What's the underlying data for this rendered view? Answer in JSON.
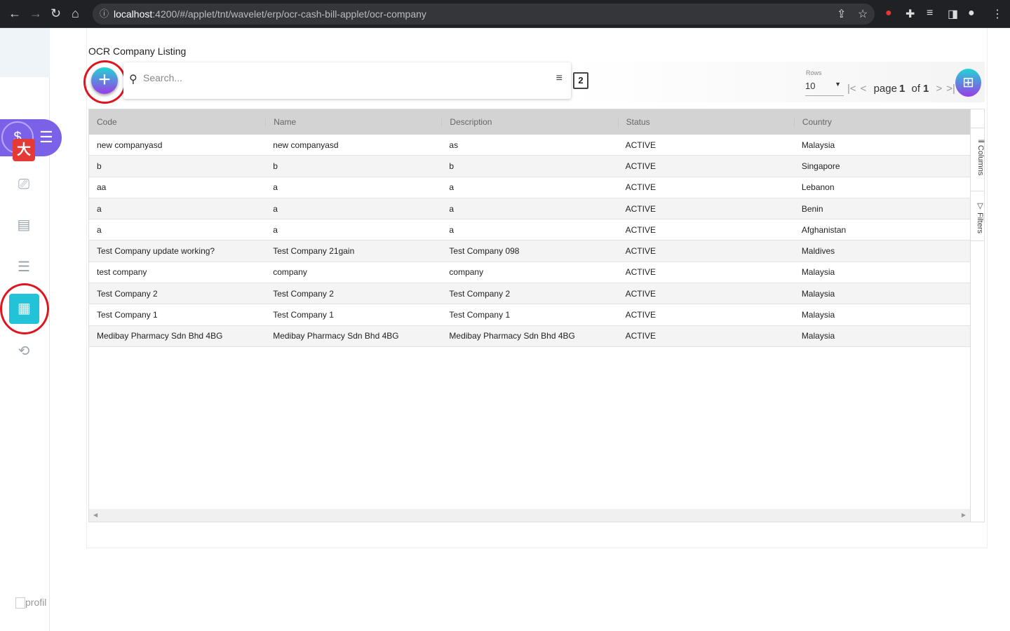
{
  "browser": {
    "url_host": "localhost",
    "url_path": ":4200/#/applet/tnt/wavelet/erp/ocr-cash-bill-applet/ocr-company"
  },
  "sidebar": {
    "profile_label": "profil"
  },
  "page": {
    "title": "OCR Company Listing",
    "search_placeholder": "Search...",
    "copy_badge": "2"
  },
  "pagination": {
    "rows_label": "Rows",
    "rows_value": "10",
    "page_word": "page",
    "current_page": "1",
    "of_word": "of",
    "total_pages": "1"
  },
  "side_tabs": {
    "columns": "Columns",
    "filters": "Filters"
  },
  "table": {
    "headers": [
      "Code",
      "Name",
      "Description",
      "Status",
      "Country"
    ],
    "rows": [
      [
        "new companyasd",
        "new companyasd",
        "as",
        "ACTIVE",
        "Malaysia"
      ],
      [
        "b",
        "b",
        "b",
        "ACTIVE",
        "Singapore"
      ],
      [
        "aa",
        "a",
        "a",
        "ACTIVE",
        "Lebanon"
      ],
      [
        "a",
        "a",
        "a",
        "ACTIVE",
        "Benin"
      ],
      [
        "a",
        "a",
        "a",
        "ACTIVE",
        "Afghanistan"
      ],
      [
        "Test Company update working?",
        "Test Company 21gain",
        "Test Company 098",
        "ACTIVE",
        "Maldives"
      ],
      [
        "test company",
        "company",
        "company",
        "ACTIVE",
        "Malaysia"
      ],
      [
        "Test Company 2",
        "Test Company 2",
        "Test Company 2",
        "ACTIVE",
        "Malaysia"
      ],
      [
        "Test Company 1",
        "Test Company 1",
        "Test Company 1",
        "ACTIVE",
        "Malaysia"
      ],
      [
        "Medibay Pharmacy Sdn Bhd 4BG",
        "Medibay Pharmacy Sdn Bhd 4BG",
        "Medibay Pharmacy Sdn Bhd 4BG",
        "ACTIVE",
        "Malaysia"
      ]
    ]
  }
}
